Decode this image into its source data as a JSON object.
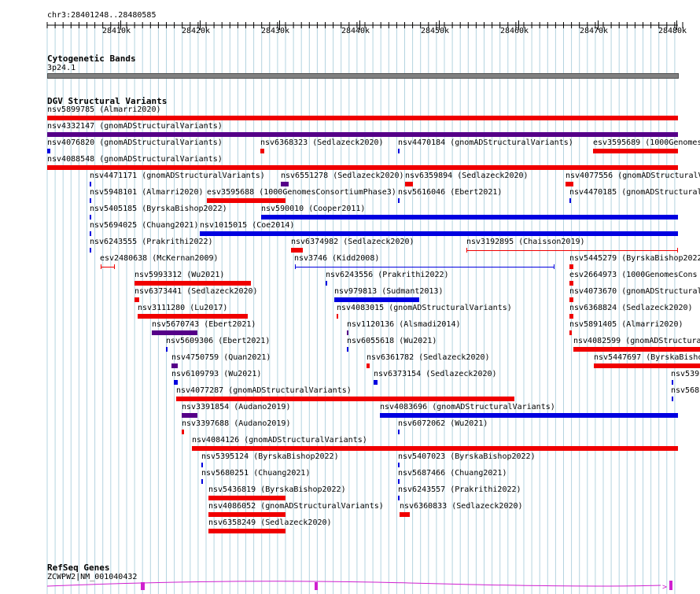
{
  "ruler": {
    "locus": "chr3:28401248..28480585",
    "ticks": [
      "28410k",
      "28420k",
      "28430k",
      "28440k",
      "28450k",
      "28460k",
      "28470k",
      "28480k"
    ]
  },
  "tracks": {
    "cytoband": {
      "title": "Cytogenetic Bands",
      "band": "3p24.1"
    },
    "dgv": {
      "title": "DGV Structural Variants"
    },
    "refseq": {
      "title": "RefSeq Genes",
      "gene": "ZCWPW2|NM_001040432"
    }
  },
  "colors": {
    "loss": "#f00000",
    "gain": "#0000e0",
    "complex": "#550088",
    "gene": "#d020d0",
    "grid": "#b4d4e0",
    "cytoband": "#808080"
  },
  "features": [
    {
      "label": "nsv5899785 (Almarri2020)",
      "type": "loss"
    },
    {
      "label": "nsv4332147 (gnomADStructuralVariants)",
      "type": "complex"
    },
    {
      "label": "nsv4076820 (gnomADStructuralVariants)",
      "type": "gain"
    },
    {
      "label": "nsv6368323 (Sedlazeck2020)",
      "type": "loss"
    },
    {
      "label": "nsv4470184 (gnomADStructuralVariants)",
      "type": "gain"
    },
    {
      "label": "esv3595689 (1000Genomes",
      "type": "loss"
    },
    {
      "label": "nsv4088548 (gnomADStructuralVariants)",
      "type": "loss"
    },
    {
      "label": "nsv4471171 (gnomADStructuralVariants)",
      "type": "gain"
    },
    {
      "label": "nsv6551278 (Sedlazeck2020)",
      "type": "complex"
    },
    {
      "label": "nsv6359894 (Sedlazeck2020)",
      "type": "loss"
    },
    {
      "label": "nsv4077556 (gnomADStructuralV",
      "type": "loss"
    },
    {
      "label": "nsv5948101 (Almarri2020)",
      "type": "gain"
    },
    {
      "label": "esv3595688 (1000GenomesConsortiumPhase3)",
      "type": "loss"
    },
    {
      "label": "nsv5616046 (Ebert2021)",
      "type": "gain"
    },
    {
      "label": "nsv4470185 (gnomADStructural",
      "type": "gain"
    },
    {
      "label": "nsv5405185 (ByrskaBishop2022)",
      "type": "gain"
    },
    {
      "label": "nsv590010 (Cooper2011)",
      "type": "gain"
    },
    {
      "label": "nsv5694025 (Chuang2021)",
      "type": "gain"
    },
    {
      "label": "nsv1015015 (Coe2014)",
      "type": "gain"
    },
    {
      "label": "nsv6243555 (Prakrithi2022)",
      "type": "gain"
    },
    {
      "label": "nsv6374982 (Sedlazeck2020)",
      "type": "loss"
    },
    {
      "label": "nsv3192895 (Chaisson2019)",
      "type": "loss"
    },
    {
      "label": "esv2480638 (McKernan2009)",
      "type": "loss"
    },
    {
      "label": "nsv3746 (Kidd2008)",
      "type": "gain"
    },
    {
      "label": "nsv5445279 (ByrskaBishop2022",
      "type": "loss"
    },
    {
      "label": "nsv5993312 (Wu2021)",
      "type": "loss"
    },
    {
      "label": "nsv6243556 (Prakrithi2022)",
      "type": "gain"
    },
    {
      "label": "esv2664973 (1000GenomesCons",
      "type": "loss"
    },
    {
      "label": "nsv6373441 (Sedlazeck2020)",
      "type": "loss"
    },
    {
      "label": "nsv979813 (Sudmant2013)",
      "type": "gain"
    },
    {
      "label": "nsv4073670 (gnomADStructural",
      "type": "loss"
    },
    {
      "label": "nsv3111280 (Lu2017)",
      "type": "loss"
    },
    {
      "label": "nsv4083015 (gnomADStructuralVariants)",
      "type": "loss"
    },
    {
      "label": "nsv6368824 (Sedlazeck2020)",
      "type": "loss"
    },
    {
      "label": "nsv5670743 (Ebert2021)",
      "type": "complex"
    },
    {
      "label": "nsv1120136 (Alsmadi2014)",
      "type": "complex"
    },
    {
      "label": "nsv5891405 (Almarri2020)",
      "type": "loss"
    },
    {
      "label": "nsv5609306 (Ebert2021)",
      "type": "gain"
    },
    {
      "label": "nsv6055618 (Wu2021)",
      "type": "gain"
    },
    {
      "label": "nsv4082599 (gnomADStructura",
      "type": "loss"
    },
    {
      "label": "nsv4750759 (Quan2021)",
      "type": "complex"
    },
    {
      "label": "nsv6361782 (Sedlazeck2020)",
      "type": "loss"
    },
    {
      "label": "nsv5447697 (ByrskaBisho",
      "type": "loss"
    },
    {
      "label": "nsv6109793 (Wu2021)",
      "type": "gain"
    },
    {
      "label": "nsv6373154 (Sedlazeck2020)",
      "type": "gain"
    },
    {
      "label": "nsv539",
      "type": "gain"
    },
    {
      "label": "nsv4077287 (gnomADStructuralVariants)",
      "type": "loss"
    },
    {
      "label": "nsv568",
      "type": "gain"
    },
    {
      "label": "nsv3391854 (Audano2019)",
      "type": "complex"
    },
    {
      "label": "nsv4083696 (gnomADStructuralVariants)",
      "type": "gain"
    },
    {
      "label": "nsv3397688 (Audano2019)",
      "type": "loss"
    },
    {
      "label": "nsv6072062 (Wu2021)",
      "type": "gain"
    },
    {
      "label": "nsv4084126 (gnomADStructuralVariants)",
      "type": "loss"
    },
    {
      "label": "nsv5395124 (ByrskaBishop2022)",
      "type": "gain"
    },
    {
      "label": "nsv5407023 (ByrskaBishop2022)",
      "type": "gain"
    },
    {
      "label": "nsv5680251 (Chuang2021)",
      "type": "gain"
    },
    {
      "label": "nsv5687466 (Chuang2021)",
      "type": "gain"
    },
    {
      "label": "nsv5436819 (ByrskaBishop2022)",
      "type": "loss"
    },
    {
      "label": "nsv6243557 (Prakrithi2022)",
      "type": "gain"
    },
    {
      "label": "nsv4086052 (gnomADStructuralVariants)",
      "type": "loss"
    },
    {
      "label": "nsv6360833 (Sedlazeck2020)",
      "type": "loss"
    },
    {
      "label": "nsv6358249 (Sedlazeck2020)",
      "type": "loss"
    }
  ]
}
